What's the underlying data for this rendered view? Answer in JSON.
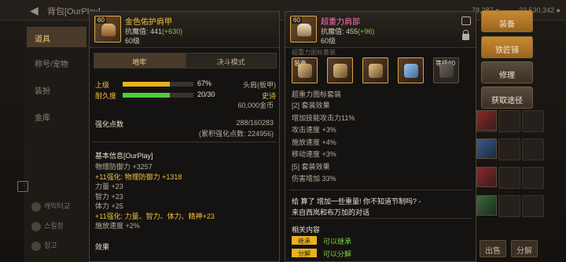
{
  "background": {
    "title": "背包[OurPlay]",
    "stat1": "78,287 ●",
    "stat2": "23,530,342 ●",
    "sidebar": [
      "道具",
      "称号/宠物",
      "装扮",
      "金库"
    ],
    "bottom_tabs": [
      "캐릭터교",
      "스킬창",
      "창고"
    ],
    "bottom_buttons": [
      "出售",
      "分解"
    ]
  },
  "left": {
    "name": "金色佑护肩甲",
    "icon_level": "60",
    "resist_label": "抗魔值: 441",
    "resist_plus": "(+630)",
    "level": "60级",
    "tab_active": "地牢",
    "tab_other": "决斗模式",
    "grade_label": "上级",
    "grade_pct": "67%",
    "grade_fill": 0.67,
    "slot_type": "头肩(板甲)",
    "durability_label": "耐久度",
    "durability_val": "20/30",
    "durability_fill": 0.667,
    "rarity": "史诗",
    "price": "60,000金币",
    "reinforce_label": "强化点数",
    "reinforce_val": "288/160283",
    "reinforce_total": "(累积强化点数: 224956)",
    "basic_header": "基本信息[OurPlay]",
    "lines": [
      {
        "t": "物理防御力 +3257",
        "c": "gray"
      },
      {
        "t": "+11强化: 物理防御力 +1318",
        "c": "gold"
      },
      {
        "t": "力量 +23",
        "c": "gray"
      },
      {
        "t": "智力 +23",
        "c": "gray"
      },
      {
        "t": "体力 +25",
        "c": "gray"
      },
      {
        "t": "+11强化: 力量、智力、体力、精神+23",
        "c": "gold"
      },
      {
        "t": "施放速度 +2%",
        "c": "gray"
      }
    ],
    "effect_header": "效果"
  },
  "right": {
    "name": "超重力肩部",
    "icon_level": "60",
    "resist_label": "抗魔值: 455",
    "resist_plus": "(+96)",
    "level": "60级",
    "section_title": "超重力图标套装",
    "slot_tags": [
      "装备",
      "等级60"
    ],
    "set_name": "超重力图标套装",
    "lines": [
      "[2] 套装效果",
      "增加技能攻击力11%",
      "攻击速度 +3%",
      "施放速度 +4%",
      "移动速度 +3%",
      "[5] 套装效果",
      "伤害增加 33%"
    ],
    "quote1": "给 算了 增加一些重量! 你不知道节制吗? -",
    "quote2": "来自西岚和布万加的对话",
    "related_header": "相关内容",
    "tag_label": "继承",
    "tag_text": "可以继承",
    "tag_label2": "分解",
    "tag_text2": "可以分解"
  },
  "actions": [
    "装备",
    "铁匠铺",
    "修理",
    "获取途径"
  ],
  "colors": {
    "gold": "#f0c040",
    "green": "#7ad13f",
    "pink": "#ff6fb6",
    "bar_gold": "#e9b21e",
    "bar_green": "#4fcf3a"
  }
}
